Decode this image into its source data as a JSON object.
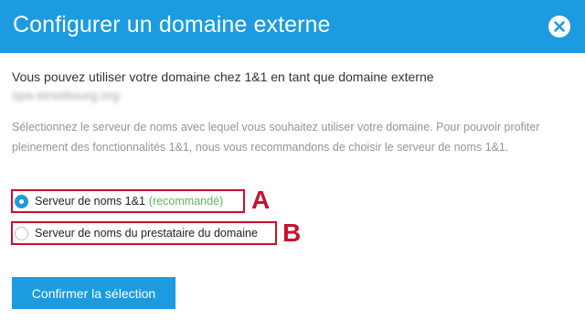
{
  "dialog": {
    "title": "Configurer un domaine externe",
    "close_icon": "close-icon",
    "intro": "Vous pouvez utiliser votre domaine chez 1&1 en tant que domaine externe",
    "domain": "spa-strasbourg.org",
    "description": "Sélectionnez le serveur de noms avec lequel vous souhaitez utiliser votre domaine. Pour pouvoir profiter pleinement des fonctionnalités 1&1, nous vous recommandons de choisir le serveur de noms 1&1."
  },
  "options": [
    {
      "label": "Serveur de noms 1&1",
      "note": "(recommandé)",
      "checked": true,
      "marker": "A"
    },
    {
      "label": "Serveur de noms du prestataire du domaine",
      "checked": false,
      "marker": "B"
    }
  ],
  "confirm_label": "Confirmer la sélection",
  "colors": {
    "accent": "#1c9be0",
    "highlight_box": "#c8102e",
    "recommended": "#5cb85c"
  }
}
